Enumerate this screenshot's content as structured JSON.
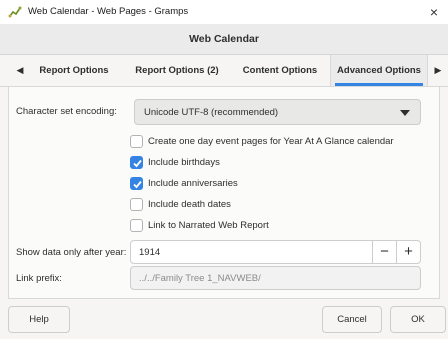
{
  "window": {
    "title": "Web Calendar - Web Pages - Gramps",
    "close_glyph": "×",
    "icon": "gramps-app-icon"
  },
  "header": {
    "title": "Web Calendar"
  },
  "tabs": {
    "prev_glyph": "◀",
    "next_glyph": "▶",
    "items": [
      {
        "label": "Report Options"
      },
      {
        "label": "Report Options (2)"
      },
      {
        "label": "Content Options"
      },
      {
        "label": "Advanced Options",
        "active": true
      }
    ]
  },
  "form": {
    "encoding": {
      "label": "Character set encoding:",
      "value": "Unicode UTF-8 (recommended)"
    },
    "checks": [
      {
        "label": "Create one day event pages for Year At A Glance calendar",
        "checked": false
      },
      {
        "label": "Include birthdays",
        "checked": true
      },
      {
        "label": "Include anniversaries",
        "checked": true
      },
      {
        "label": "Include death dates",
        "checked": false
      },
      {
        "label": "Link to Narrated Web Report",
        "checked": false
      }
    ],
    "after_year": {
      "label": "Show data only after year:",
      "value": "1914",
      "minus": "−",
      "plus": "+"
    },
    "link_prefix": {
      "label": "Link prefix:",
      "value": "../../Family Tree 1_NAVWEB/"
    }
  },
  "buttons": {
    "help": "Help",
    "cancel": "Cancel",
    "ok": "OK"
  },
  "colors": {
    "accent": "#3584e4",
    "background": "#f6f5f4"
  }
}
